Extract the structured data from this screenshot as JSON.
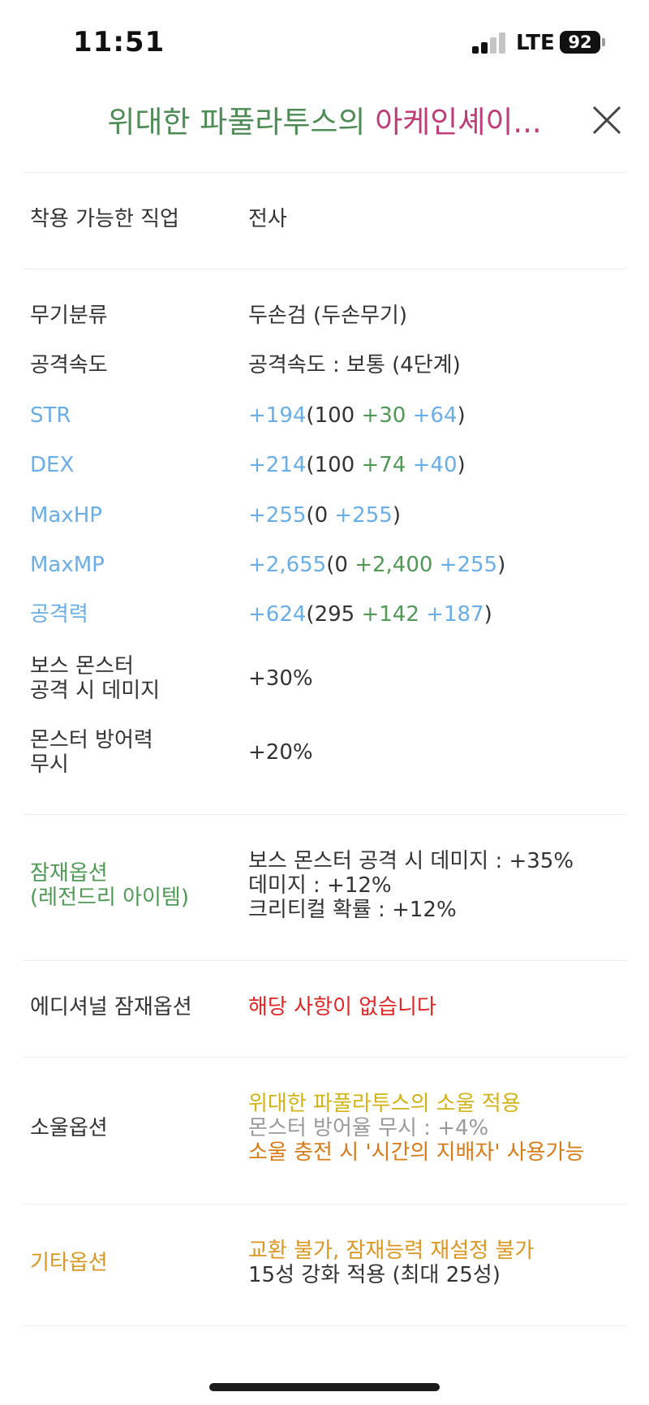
{
  "status_bar": {
    "time": "11:51",
    "network": "LTE",
    "battery": "92"
  },
  "header": {
    "title_part1": "위대한 파풀라투스의",
    "title_part2": "아케인셰이..."
  },
  "job": {
    "label": "착용 가능한 직업",
    "value": "전사"
  },
  "weapon_type": {
    "label": "무기분류",
    "value": "두손검 (두손무기)"
  },
  "attack_speed": {
    "label": "공격속도",
    "value": "공격속도 : 보통 (4단계)"
  },
  "stats": [
    {
      "name": "STR",
      "total": "+194",
      "base": "100",
      "enhance": "+30",
      "flame": "+64"
    },
    {
      "name": "DEX",
      "total": "+214",
      "base": "100",
      "enhance": "+74",
      "flame": "+40"
    },
    {
      "name": "MaxHP",
      "total": "+255",
      "base": "0",
      "flame": "+255"
    },
    {
      "name": "MaxMP",
      "total": "+2,655",
      "base": "0",
      "enhance": "+2,400",
      "flame": "+255"
    },
    {
      "name": "공격력",
      "total": "+624",
      "base": "295",
      "enhance": "+142",
      "flame": "+187"
    }
  ],
  "boss_damage": {
    "label_line1": "보스 몬스터",
    "label_line2": "공격 시 데미지",
    "value": "+30%"
  },
  "ignore_def": {
    "label_line1": "몬스터 방어력",
    "label_line2": "무시",
    "value": "+20%"
  },
  "potential": {
    "label_line1": "잠재옵션",
    "label_line2": "(레전드리 아이템)",
    "lines": [
      "보스 몬스터 공격 시 데미지 : +35%",
      "데미지 : +12%",
      "크리티컬 확률 : +12%"
    ]
  },
  "additional": {
    "label": "에디셔널 잠재옵션",
    "value": "해당 사항이 없습니다"
  },
  "soul": {
    "label": "소울옵션",
    "line1": "위대한 파풀라투스의 소울 적용",
    "line2": "몬스터 방어율 무시 : +4%",
    "line3": "소울 충전 시 '시간의 지배자' 사용가능"
  },
  "etc": {
    "label": "기타옵션",
    "line1": "교환 불가, 잠재능력 재설정 불가",
    "line2": "15성 강화 적용 (최대 25성)"
  },
  "colors": {
    "title_green": "#4e8c55",
    "title_pink": "#bf3c79",
    "stat_blue": "#6aaee8",
    "enhance_green": "#4e9a55",
    "warning_red": "#e02525",
    "soul_yellow": "#d2b217",
    "etc_orange": "#d99620"
  },
  "icons": {
    "close": "close-icon",
    "signal": "cellular-signal-icon",
    "battery": "battery-icon"
  }
}
